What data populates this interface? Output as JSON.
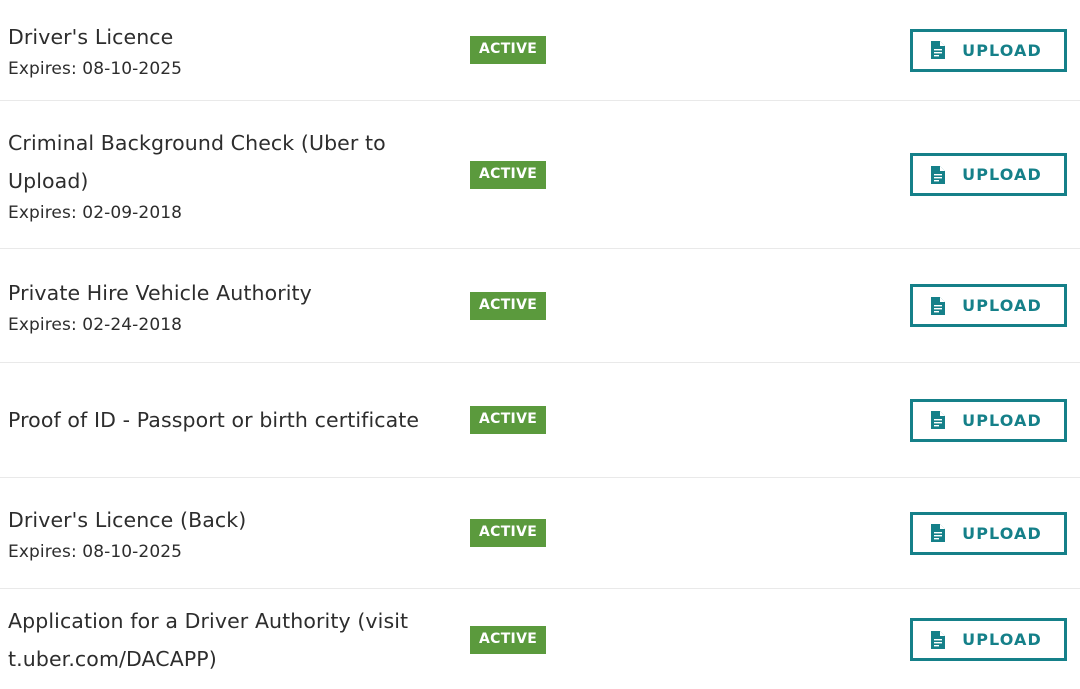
{
  "colors": {
    "status_active_bg": "#5b9a3d",
    "status_active_text": "#ffffff",
    "accent_teal": "#158089",
    "row_divider": "#e9e9e9",
    "text_primary": "#2d2d2d",
    "page_bg": "#ffffff"
  },
  "action": {
    "upload_label": "UPLOAD",
    "upload_icon": "document-file-icon"
  },
  "status": {
    "active_label": "ACTIVE"
  },
  "documents": [
    {
      "title": "Driver's Licence",
      "expiry": "Expires: 08-10-2025",
      "status": "ACTIVE",
      "action": "UPLOAD"
    },
    {
      "title": "Criminal Background Check (Uber to Upload)",
      "expiry": "Expires: 02-09-2018",
      "status": "ACTIVE",
      "action": "UPLOAD"
    },
    {
      "title": "Private Hire Vehicle Authority",
      "expiry": "Expires: 02-24-2018",
      "status": "ACTIVE",
      "action": "UPLOAD"
    },
    {
      "title": "Proof of ID - Passport or birth certificate",
      "expiry": "",
      "status": "ACTIVE",
      "action": "UPLOAD"
    },
    {
      "title": "Driver's Licence (Back)",
      "expiry": "Expires: 08-10-2025",
      "status": "ACTIVE",
      "action": "UPLOAD"
    },
    {
      "title": "Application for a Driver Authority (visit t.uber.com/DACAPP)",
      "expiry": "",
      "status": "ACTIVE",
      "action": "UPLOAD"
    }
  ]
}
